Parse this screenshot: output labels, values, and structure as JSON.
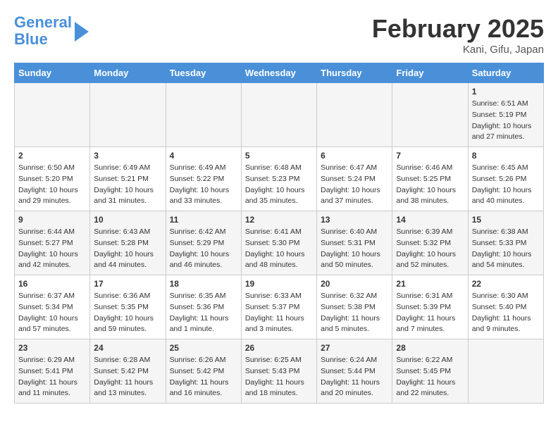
{
  "header": {
    "logo_line1": "General",
    "logo_line2": "Blue",
    "month": "February 2025",
    "location": "Kani, Gifu, Japan"
  },
  "weekdays": [
    "Sunday",
    "Monday",
    "Tuesday",
    "Wednesday",
    "Thursday",
    "Friday",
    "Saturday"
  ],
  "weeks": [
    [
      {
        "day": "",
        "info": ""
      },
      {
        "day": "",
        "info": ""
      },
      {
        "day": "",
        "info": ""
      },
      {
        "day": "",
        "info": ""
      },
      {
        "day": "",
        "info": ""
      },
      {
        "day": "",
        "info": ""
      },
      {
        "day": "1",
        "info": "Sunrise: 6:51 AM\nSunset: 5:19 PM\nDaylight: 10 hours and 27 minutes."
      }
    ],
    [
      {
        "day": "2",
        "info": "Sunrise: 6:50 AM\nSunset: 5:20 PM\nDaylight: 10 hours and 29 minutes."
      },
      {
        "day": "3",
        "info": "Sunrise: 6:49 AM\nSunset: 5:21 PM\nDaylight: 10 hours and 31 minutes."
      },
      {
        "day": "4",
        "info": "Sunrise: 6:49 AM\nSunset: 5:22 PM\nDaylight: 10 hours and 33 minutes."
      },
      {
        "day": "5",
        "info": "Sunrise: 6:48 AM\nSunset: 5:23 PM\nDaylight: 10 hours and 35 minutes."
      },
      {
        "day": "6",
        "info": "Sunrise: 6:47 AM\nSunset: 5:24 PM\nDaylight: 10 hours and 37 minutes."
      },
      {
        "day": "7",
        "info": "Sunrise: 6:46 AM\nSunset: 5:25 PM\nDaylight: 10 hours and 38 minutes."
      },
      {
        "day": "8",
        "info": "Sunrise: 6:45 AM\nSunset: 5:26 PM\nDaylight: 10 hours and 40 minutes."
      }
    ],
    [
      {
        "day": "9",
        "info": "Sunrise: 6:44 AM\nSunset: 5:27 PM\nDaylight: 10 hours and 42 minutes."
      },
      {
        "day": "10",
        "info": "Sunrise: 6:43 AM\nSunset: 5:28 PM\nDaylight: 10 hours and 44 minutes."
      },
      {
        "day": "11",
        "info": "Sunrise: 6:42 AM\nSunset: 5:29 PM\nDaylight: 10 hours and 46 minutes."
      },
      {
        "day": "12",
        "info": "Sunrise: 6:41 AM\nSunset: 5:30 PM\nDaylight: 10 hours and 48 minutes."
      },
      {
        "day": "13",
        "info": "Sunrise: 6:40 AM\nSunset: 5:31 PM\nDaylight: 10 hours and 50 minutes."
      },
      {
        "day": "14",
        "info": "Sunrise: 6:39 AM\nSunset: 5:32 PM\nDaylight: 10 hours and 52 minutes."
      },
      {
        "day": "15",
        "info": "Sunrise: 6:38 AM\nSunset: 5:33 PM\nDaylight: 10 hours and 54 minutes."
      }
    ],
    [
      {
        "day": "16",
        "info": "Sunrise: 6:37 AM\nSunset: 5:34 PM\nDaylight: 10 hours and 57 minutes."
      },
      {
        "day": "17",
        "info": "Sunrise: 6:36 AM\nSunset: 5:35 PM\nDaylight: 10 hours and 59 minutes."
      },
      {
        "day": "18",
        "info": "Sunrise: 6:35 AM\nSunset: 5:36 PM\nDaylight: 11 hours and 1 minute."
      },
      {
        "day": "19",
        "info": "Sunrise: 6:33 AM\nSunset: 5:37 PM\nDaylight: 11 hours and 3 minutes."
      },
      {
        "day": "20",
        "info": "Sunrise: 6:32 AM\nSunset: 5:38 PM\nDaylight: 11 hours and 5 minutes."
      },
      {
        "day": "21",
        "info": "Sunrise: 6:31 AM\nSunset: 5:39 PM\nDaylight: 11 hours and 7 minutes."
      },
      {
        "day": "22",
        "info": "Sunrise: 6:30 AM\nSunset: 5:40 PM\nDaylight: 11 hours and 9 minutes."
      }
    ],
    [
      {
        "day": "23",
        "info": "Sunrise: 6:29 AM\nSunset: 5:41 PM\nDaylight: 11 hours and 11 minutes."
      },
      {
        "day": "24",
        "info": "Sunrise: 6:28 AM\nSunset: 5:42 PM\nDaylight: 11 hours and 13 minutes."
      },
      {
        "day": "25",
        "info": "Sunrise: 6:26 AM\nSunset: 5:42 PM\nDaylight: 11 hours and 16 minutes."
      },
      {
        "day": "26",
        "info": "Sunrise: 6:25 AM\nSunset: 5:43 PM\nDaylight: 11 hours and 18 minutes."
      },
      {
        "day": "27",
        "info": "Sunrise: 6:24 AM\nSunset: 5:44 PM\nDaylight: 11 hours and 20 minutes."
      },
      {
        "day": "28",
        "info": "Sunrise: 6:22 AM\nSunset: 5:45 PM\nDaylight: 11 hours and 22 minutes."
      },
      {
        "day": "",
        "info": ""
      }
    ]
  ]
}
